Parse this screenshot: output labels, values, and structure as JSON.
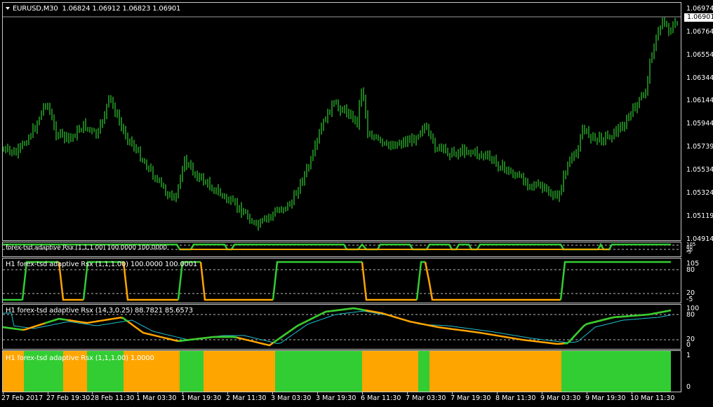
{
  "main": {
    "symbol": "EURUSD,M30",
    "ohlc": "1.06824 1.06912 1.06823 1.06901",
    "current_price": "1.06901",
    "price_labels": [
      "1.06974",
      "1.06764",
      "1.06554",
      "1.06344",
      "1.06144",
      "1.05944",
      "1.05739",
      "1.05534",
      "1.05324",
      "1.05119",
      "1.04914"
    ],
    "candle_color": "#5fb832"
  },
  "ind1": {
    "title": "forex-tsd adaptive Rsx (1,1,1.00) 100.0000 100.0000",
    "labels": [
      "105",
      "80",
      "20",
      "-5"
    ]
  },
  "ind2": {
    "title": "H1 forex-tsd adaptive Rsx (1,1,1.00) 100.0000 100.0001",
    "labels": [
      "105",
      "80",
      "20",
      "-5"
    ]
  },
  "ind3": {
    "title": "H1 forex-tsd adaptive Rsx (14,3,0.25) 88.7821 85.6573",
    "labels": [
      "100",
      "80",
      "20",
      "0"
    ]
  },
  "ind4": {
    "title": "H1 forex-tsd adaptive Rsx (1,1,1.00) 1.0000",
    "labels": [
      "1",
      "0"
    ]
  },
  "colors": {
    "green": "#32cd32",
    "orange": "#ffa500",
    "signal": "#20c0d0"
  },
  "time_labels": [
    "27 Feb 2017",
    "27 Feb 19:30",
    "28 Feb 11:30",
    "1 Mar 03:30",
    "1 Mar 19:30",
    "2 Mar 11:30",
    "3 Mar 03:30",
    "3 Mar 19:30",
    "6 Mar 11:30",
    "7 Mar 03:30",
    "7 Mar 19:30",
    "8 Mar 11:30",
    "9 Mar 03:30",
    "9 Mar 19:30",
    "10 Mar 11:30"
  ]
}
